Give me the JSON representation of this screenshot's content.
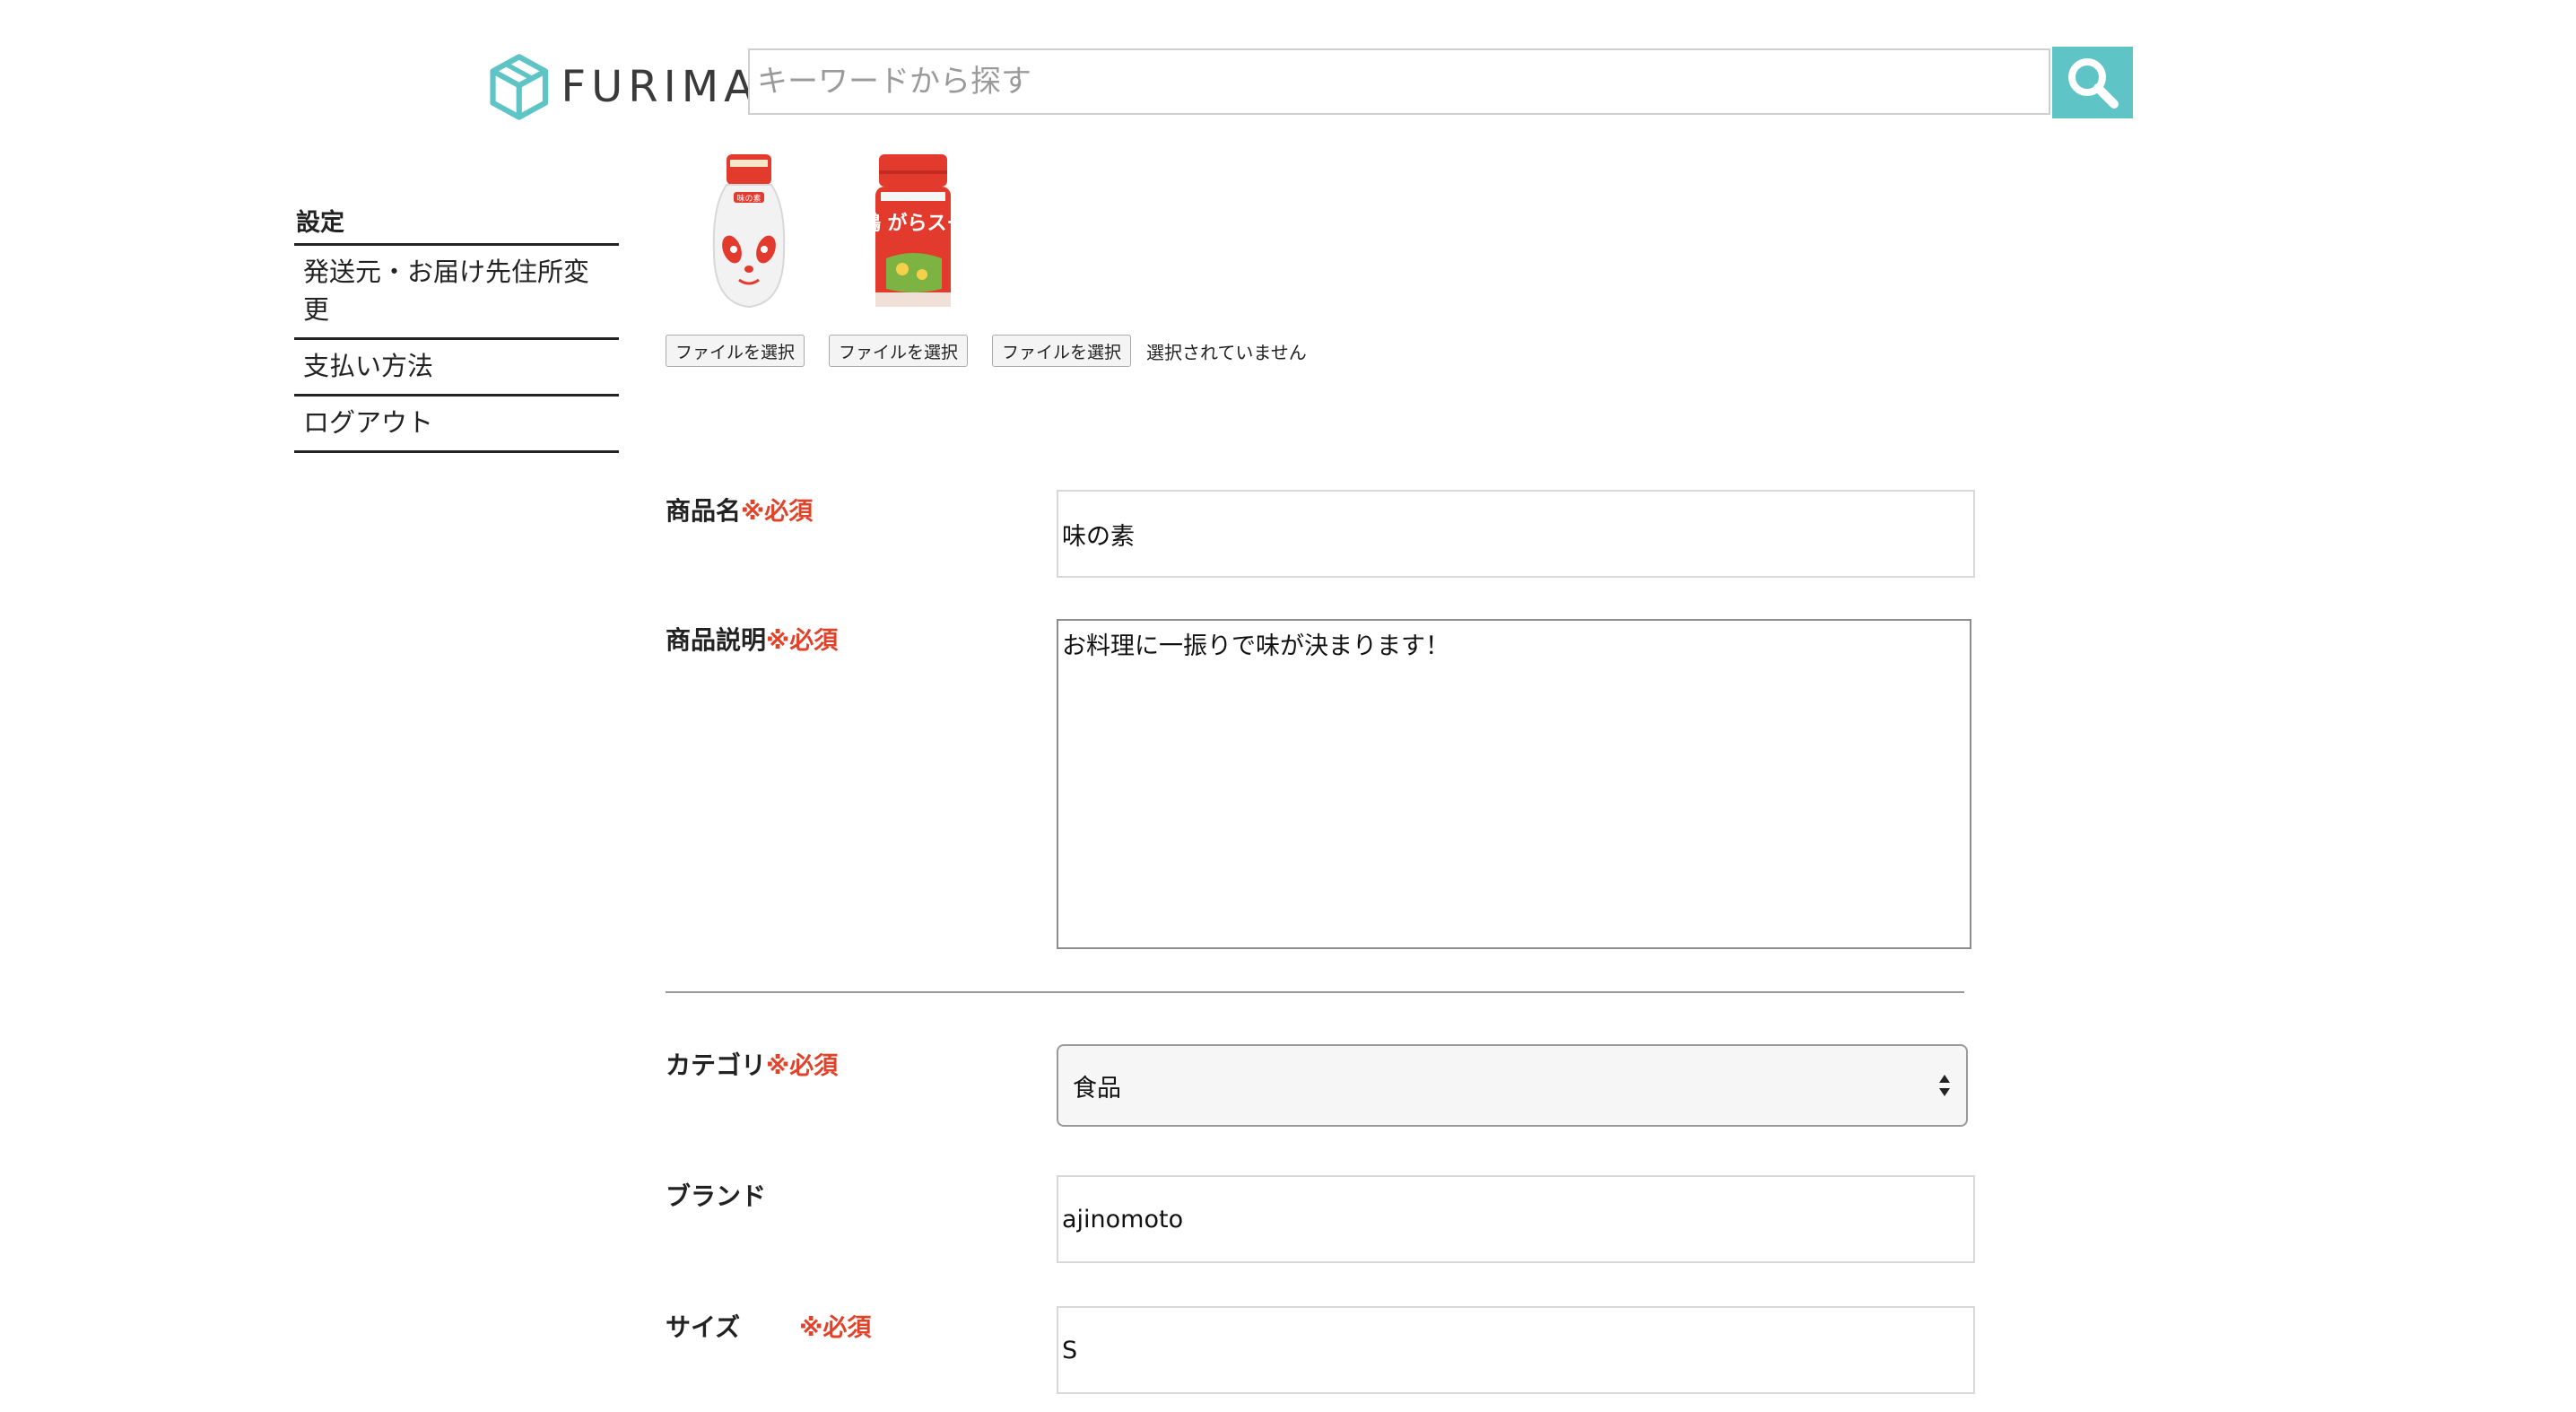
{
  "header": {
    "logo_text": "FURIMA",
    "search_placeholder": "キーワードから探す"
  },
  "sidebar": {
    "title": "設定",
    "items": [
      {
        "label": "発送元・お届け先住所変更"
      },
      {
        "label": "支払い方法"
      },
      {
        "label": "ログアウト"
      }
    ]
  },
  "images": {
    "file_button_label": "ファイルを選択",
    "no_file_text": "選択されていません",
    "thumbnails": [
      {
        "name": "味の素",
        "label": "味の素"
      },
      {
        "name": "丸鶏がらスープ",
        "label": "丸鶏 がらスープ"
      }
    ]
  },
  "form": {
    "required_mark": "※必須",
    "product_name": {
      "label": "商品名",
      "value": "味の素"
    },
    "description": {
      "label": "商品説明",
      "value": "お料理に一振りで味が決まります！"
    },
    "category": {
      "label": "カテゴリ",
      "value": "食品"
    },
    "brand": {
      "label": "ブランド",
      "value": "ajinomoto"
    },
    "size": {
      "label": "サイズ",
      "value": "S"
    }
  },
  "colors": {
    "accent": "#5fc4c5",
    "required": "#e0432a",
    "logo_icon": "#5fc4c5"
  }
}
